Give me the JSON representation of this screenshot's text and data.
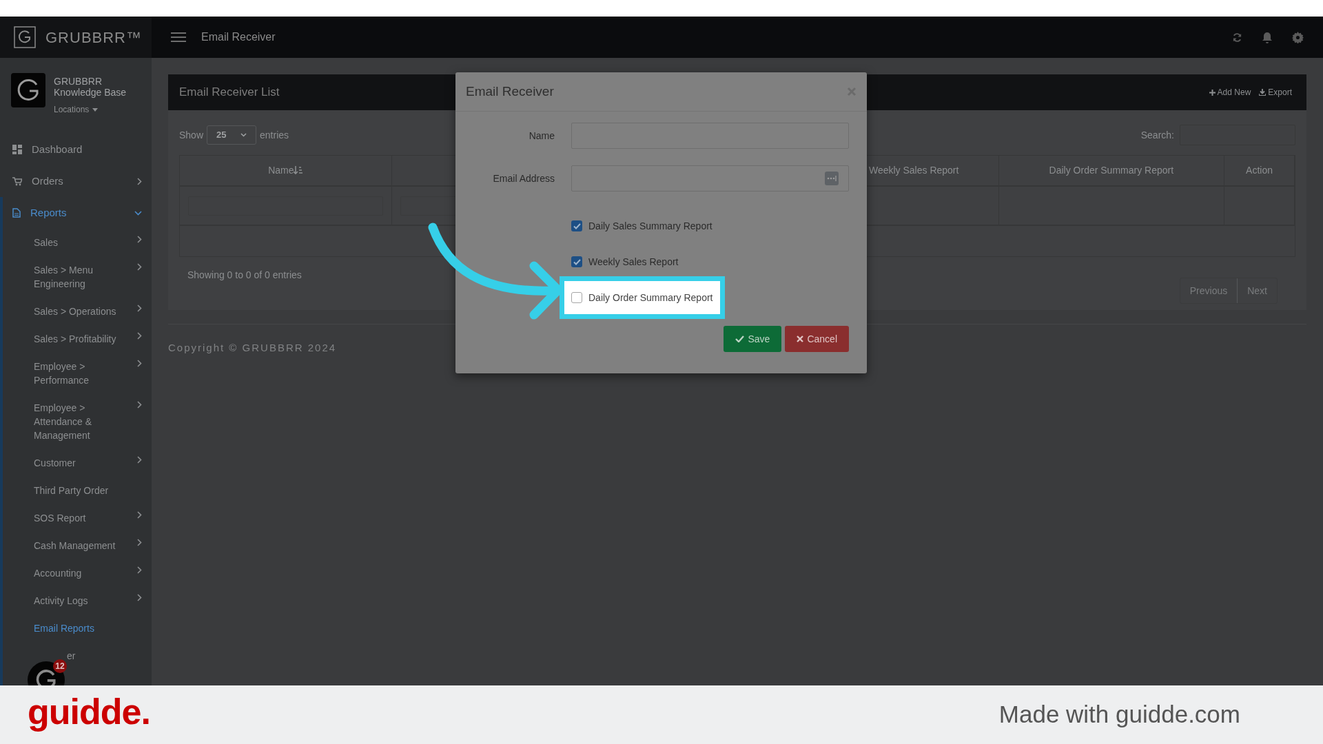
{
  "brand": {
    "name": "GRUBBRR™"
  },
  "header": {
    "title": "Email Receiver"
  },
  "profile": {
    "name_line_1": "GRUBBRR",
    "name_line_2": "Knowledge Base",
    "locations": "Locations"
  },
  "sidebar": {
    "items": [
      {
        "label": "Dashboard",
        "selected": false,
        "has_submenu": false
      },
      {
        "label": "Orders",
        "selected": false,
        "has_submenu": true,
        "expanded": false
      },
      {
        "label": "Reports",
        "selected": true,
        "has_submenu": true,
        "expanded": true,
        "children": [
          {
            "label": "Sales",
            "selected": false,
            "has_submenu": true
          },
          {
            "label": "Sales > Menu Engineering",
            "selected": false,
            "has_submenu": true
          },
          {
            "label": "Sales > Operations",
            "selected": false,
            "has_submenu": true
          },
          {
            "label": "Sales > Profitability",
            "selected": false,
            "has_submenu": true
          },
          {
            "label": "Employee > Performance",
            "selected": false,
            "has_submenu": true
          },
          {
            "label": "Employee > Attendance & Management",
            "selected": false,
            "has_submenu": true
          },
          {
            "label": "Customer",
            "selected": false,
            "has_submenu": true
          },
          {
            "label": "Third Party Order",
            "selected": false,
            "has_submenu": false
          },
          {
            "label": "SOS Report",
            "selected": false,
            "has_submenu": true
          },
          {
            "label": "Cash Management",
            "selected": false,
            "has_submenu": true
          },
          {
            "label": "Accounting",
            "selected": false,
            "has_submenu": true
          },
          {
            "label": "Activity Logs",
            "selected": false,
            "has_submenu": true
          },
          {
            "label": "Email Reports",
            "selected": true,
            "has_submenu": false
          },
          {
            "label": "er",
            "selected": false
          }
        ]
      }
    ]
  },
  "panel": {
    "title": "Email Receiver List",
    "actions": [
      {
        "label": "Add New",
        "kind": "add"
      },
      {
        "label": "Export",
        "kind": "export"
      }
    ],
    "length": {
      "label_before": "Show",
      "value": "25",
      "label_after": "entries"
    },
    "search": {
      "label": "Search:"
    },
    "table": {
      "columns": [
        {
          "label": "Name",
          "sortable": true
        },
        {
          "label": "Weekly Sales Report",
          "sortable": false
        },
        {
          "label": "Daily Order Summary Report",
          "sortable": false
        },
        {
          "label": "Action",
          "sortable": false
        }
      ]
    },
    "info": "Showing 0 to 0 of 0 entries",
    "pagination": [
      {
        "label": "Previous",
        "disabled": true
      },
      {
        "label": "Next",
        "disabled": true
      }
    ]
  },
  "copyright": "Copyright © GRUBBRR 2024",
  "modal": {
    "title": "Email Receiver",
    "fields": [
      {
        "label": "Name",
        "kind": "text"
      },
      {
        "label": "Email Address",
        "kind": "email"
      }
    ],
    "checkboxes": [
      {
        "label": "Daily Sales Summary Report",
        "checked": true,
        "highlighted": false
      },
      {
        "label": "Weekly Sales Report",
        "checked": true,
        "highlighted": false
      },
      {
        "label": "Daily Order Summary Report",
        "checked": false,
        "highlighted": true
      }
    ],
    "buttons": [
      {
        "label": "Save",
        "kind": "save"
      },
      {
        "label": "Cancel",
        "kind": "cancel"
      }
    ]
  },
  "chat": {
    "badge": "12"
  },
  "footer": {
    "logo": "guidde.",
    "credit": "Made with guidde.com"
  }
}
